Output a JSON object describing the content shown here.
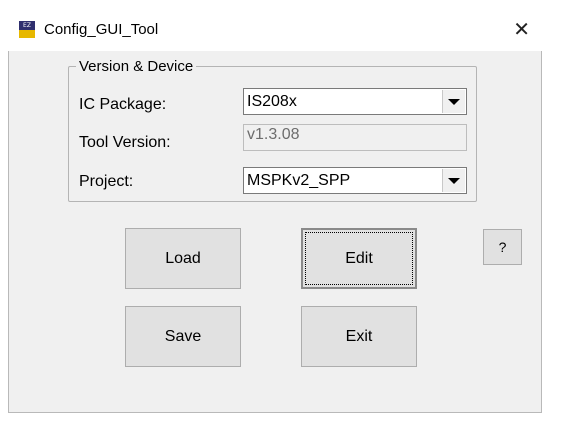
{
  "window": {
    "title": "Config_GUI_Tool",
    "icon": "app-icon",
    "close_icon": "close-icon",
    "close_glyph": "✕"
  },
  "group": {
    "label": "Version & Device",
    "ic_package": {
      "label": "IC Package:",
      "value": "IS208x"
    },
    "tool_version": {
      "label": "Tool Version:",
      "value": "v1.3.08"
    },
    "project": {
      "label": "Project:",
      "value": "MSPKv2_SPP"
    }
  },
  "buttons": {
    "load": "Load",
    "edit": "Edit",
    "help": "?",
    "save": "Save",
    "exit": "Exit"
  }
}
